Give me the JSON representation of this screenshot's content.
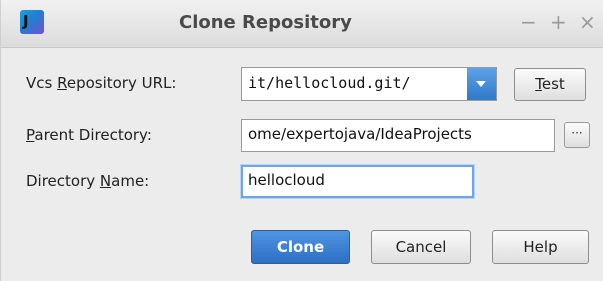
{
  "window": {
    "title": "Clone Repository",
    "logo_text": "J",
    "controls": {
      "minimize": "−",
      "maximize": "+",
      "close": "×"
    }
  },
  "form": {
    "url": {
      "label_pre": "Vcs ",
      "label_mnemonic": "R",
      "label_post": "epository URL:",
      "value": "it/hellocloud.git/"
    },
    "parent_dir": {
      "label_mnemonic": "P",
      "label_post": "arent Directory:",
      "value": "ome/expertojava/IdeaProjects",
      "browse_label": "···"
    },
    "dir_name": {
      "label_pre": "Directory ",
      "label_mnemonic": "N",
      "label_post": "ame:",
      "value": "hellocloud"
    }
  },
  "buttons": {
    "test_mnemonic": "T",
    "test_post": "est",
    "clone": "Clone",
    "cancel": "Cancel",
    "help": "Help"
  },
  "colors": {
    "accent": "#2f79c9",
    "focus": "#6aa6e9"
  }
}
